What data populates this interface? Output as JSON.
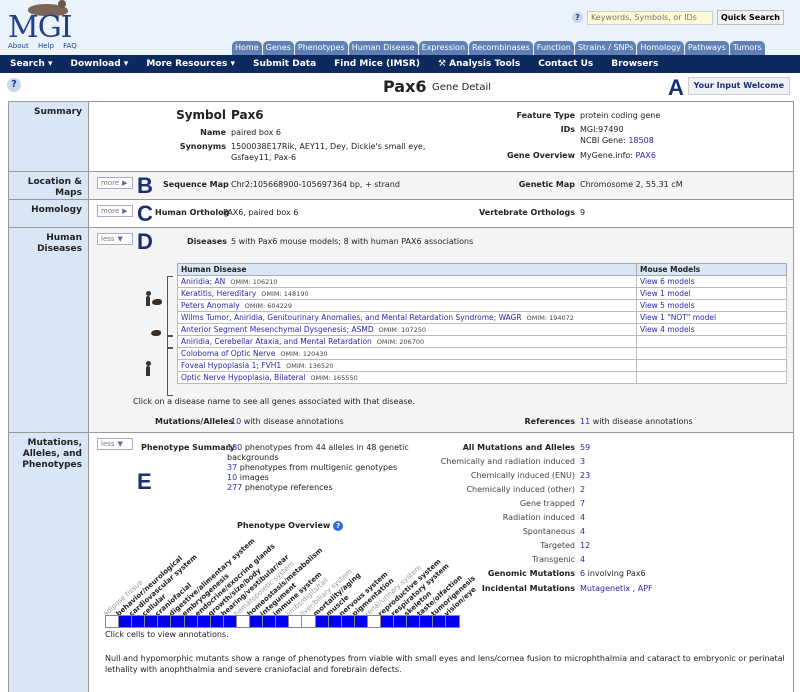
{
  "header": {
    "logo_text": "MGI",
    "top_links": [
      "About",
      "Help",
      "FAQ"
    ],
    "search_placeholder": "Keywords, Symbols, or IDs",
    "quick_search_label": "Quick Search",
    "tabs": [
      "Home",
      "Genes",
      "Phenotypes",
      "Human Disease",
      "Expression",
      "Recombinases",
      "Function",
      "Strains / SNPs",
      "Homology",
      "Pathways",
      "Tumors"
    ],
    "nav": [
      "Search ▾",
      "Download ▾",
      "More Resources ▾",
      "Submit Data",
      "Find Mice (IMSR)",
      "⚒ Analysis Tools",
      "Contact Us",
      "Browsers"
    ]
  },
  "title": {
    "symbol": "Pax6",
    "subtitle": "Gene Detail",
    "marker_a": "A",
    "input_welcome": "Your Input Welcome"
  },
  "summary": {
    "label": "Summary",
    "symbol_label": "Symbol",
    "symbol": "Pax6",
    "name_label": "Name",
    "name": "paired box 6",
    "synonyms_label": "Synonyms",
    "synonyms_1": "1500038E17Rik, AEY11, Dey, Dickie's small eye,",
    "synonyms_2": "Gsfaey11, Pax-6",
    "feature_type_label": "Feature Type",
    "feature_type": "protein coding gene",
    "ids_label": "IDs",
    "mgi_id": "MGI:97490",
    "ncbi_prefix": "NCBI Gene:",
    "ncbi_id": "18508",
    "overview_label": "Gene Overview",
    "overview_prefix": "MyGene.info:",
    "overview_link": "PAX6"
  },
  "location": {
    "label_1": "Location &",
    "label_2": "Maps",
    "toggle": "more",
    "marker": "B",
    "seq_label": "Sequence Map",
    "seq_value": "Chr2:105668900-105697364 bp, + strand",
    "gen_label": "Genetic Map",
    "gen_value": "Chromosome 2, 55.31 cM"
  },
  "homology": {
    "label": "Homology",
    "toggle": "more",
    "marker": "C",
    "ortholog_label": "Human Ortholog",
    "ortholog_value": "PAX6, paired box 6",
    "vert_label": "Vertebrate Orthologs",
    "vert_value": "9"
  },
  "diseases": {
    "label_1": "Human",
    "label_2": "Diseases",
    "toggle": "less",
    "marker": "D",
    "diseases_label": "Diseases",
    "diseases_value": "5 with Pax6 mouse models; 8 with human PAX6 associations",
    "col_disease": "Human Disease",
    "col_models": "Mouse Models",
    "rows": [
      {
        "name": "Aniridia; AN",
        "omim": "OMIM: 106210",
        "models": "View 6 models"
      },
      {
        "name": "Keratitis, Hereditary",
        "omim": "OMIM: 148190",
        "models": "View 1 model"
      },
      {
        "name": "Peters Anomaly",
        "omim": "OMIM: 604229",
        "models": "View 5 models"
      },
      {
        "name": "Wilms Tumor, Aniridia, Genitourinary Anomalies, and Mental Retardation Syndrome; WAGR",
        "omim": "OMIM: 194072",
        "models": "View 1 \"NOT\" model"
      },
      {
        "name": "Anterior Segment Mesenchymal Dysgenesis; ASMD",
        "omim": "OMIM: 107250",
        "models": "View 4 models"
      },
      {
        "name": "Aniridia, Cerebellar Ataxia, and Mental Retardation",
        "omim": "OMIM: 206700",
        "models": ""
      },
      {
        "name": "Coloboma of Optic Nerve",
        "omim": "OMIM: 120430",
        "models": ""
      },
      {
        "name": "Foveal Hypoplasia 1; FVH1",
        "omim": "OMIM: 136520",
        "models": ""
      },
      {
        "name": "Optic Nerve Hypoplasia, Bilateral",
        "omim": "OMIM: 165550",
        "models": ""
      }
    ],
    "note": "Click on a disease name to see all genes associated with that disease.",
    "alleles_label": "Mutations/Alleles",
    "alleles_count": "10",
    "alleles_text": "with disease annotations",
    "refs_label": "References",
    "refs_count": "11",
    "refs_text": "with disease annotations"
  },
  "mutations": {
    "label_1": "Mutations,",
    "label_2": "Alleles, and",
    "label_3": "Phenotypes",
    "toggle": "less",
    "marker": "E",
    "summary_label": "Phenotype Summary",
    "summary": [
      {
        "count": "180",
        "text": "phenotypes from 44 alleles in 48 genetic"
      },
      {
        "count": "",
        "text": "backgrounds"
      },
      {
        "count": "37",
        "text": "phenotypes from multigenic genotypes"
      },
      {
        "count": "10",
        "text": "images"
      },
      {
        "count": "277",
        "text": "phenotype references"
      }
    ],
    "overview_title": "Phenotype Overview",
    "overview_note": "Click cells to view annotations.",
    "categories": [
      {
        "name": "adipose tissue",
        "on": false
      },
      {
        "name": "behavior/neurological",
        "on": true
      },
      {
        "name": "cardiovascular system",
        "on": true
      },
      {
        "name": "cellular",
        "on": true
      },
      {
        "name": "craniofacial",
        "on": true
      },
      {
        "name": "digestive/alimentary system",
        "on": true
      },
      {
        "name": "embryogenesis",
        "on": true
      },
      {
        "name": "endocrine/exocrine glands",
        "on": true
      },
      {
        "name": "growth/size/body",
        "on": true
      },
      {
        "name": "hearing/vestibular/ear",
        "on": true
      },
      {
        "name": "hematopoietic system",
        "on": false
      },
      {
        "name": "homeostasis/metabolism",
        "on": true
      },
      {
        "name": "integument",
        "on": true
      },
      {
        "name": "immune system",
        "on": true
      },
      {
        "name": "limbs/digits/tail",
        "on": false
      },
      {
        "name": "liver/biliary system",
        "on": false
      },
      {
        "name": "mortality/aging",
        "on": true
      },
      {
        "name": "muscle",
        "on": true
      },
      {
        "name": "nervous system",
        "on": true
      },
      {
        "name": "pigmentation",
        "on": true
      },
      {
        "name": "renal/urinary system",
        "on": false
      },
      {
        "name": "reproductive system",
        "on": true
      },
      {
        "name": "respiratory system",
        "on": true
      },
      {
        "name": "skeleton",
        "on": true
      },
      {
        "name": "taste/olfaction",
        "on": true
      },
      {
        "name": "tumorigenesis",
        "on": true
      },
      {
        "name": "vision/eye",
        "on": true
      }
    ],
    "all_label": "All Mutations and Alleles",
    "all_count": "59",
    "allele_types": [
      {
        "label": "Chemically and radiation induced",
        "count": "3"
      },
      {
        "label": "Chemically induced (ENU)",
        "count": "23"
      },
      {
        "label": "Chemically induced (other)",
        "count": "2"
      },
      {
        "label": "Gene trapped",
        "count": "7"
      },
      {
        "label": "Radiation induced",
        "count": "4"
      },
      {
        "label": "Spontaneous",
        "count": "4"
      },
      {
        "label": "Targeted",
        "count": "12"
      },
      {
        "label": "Transgenic",
        "count": "4"
      }
    ],
    "genomic_label": "Genomic Mutations",
    "genomic_count": "6",
    "genomic_text": "involving Pax6",
    "incidental_label": "Incidental Mutations",
    "incidental_link_1": "Mutagenetix",
    "incidental_link_2": "APF",
    "description": "Null and hypomorphic mutants show a range of phenotypes from viable with small eyes and lens/cornea fusion to microphthalmia and cataract to embryonic or perinatal lethality with anophthalmia and severe craniofacial and forebrain defects."
  },
  "colors": {
    "nav_bg": "#0d2a5e",
    "label_bg": "#d8e6f6",
    "link": "#2a2aa8",
    "annotated_cell": "#0000ee"
  }
}
